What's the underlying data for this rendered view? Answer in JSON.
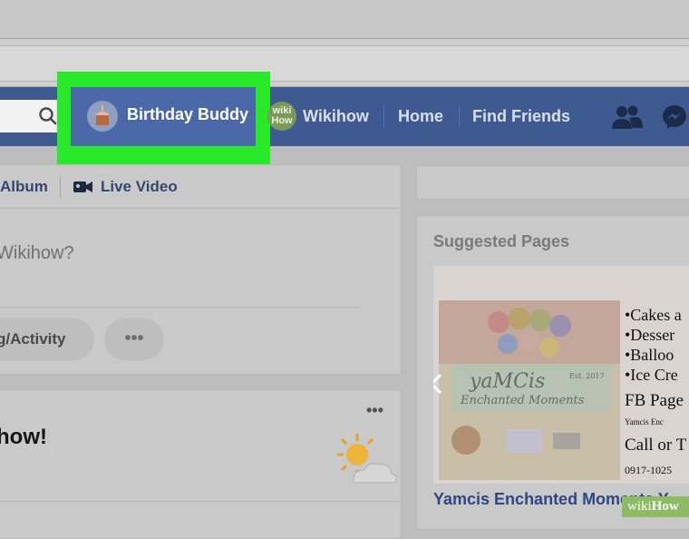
{
  "browser": {},
  "header": {
    "profile_name": "Birthday Buddy",
    "page_avatar_text": [
      "wiki",
      "How"
    ],
    "page_name": "Wikihow",
    "home_label": "Home",
    "find_friends_label": "Find Friends",
    "icons": [
      "search-icon",
      "friends-icon",
      "messenger-icon"
    ]
  },
  "composer": {
    "album_label": "Album",
    "live_video_label": "Live Video",
    "prompt": "Wikihow?",
    "activity_label": "g/Activity",
    "more_label": "•••"
  },
  "post": {
    "text": "how!",
    "more_label": "•••"
  },
  "sidebar": {
    "suggested_title": "Suggested Pages",
    "ad": {
      "logo_text": "yaMCis",
      "logo_subtext": "Enchanted Moments",
      "est": "Est. 2017",
      "bullets": [
        "•Cakes a",
        "•Desser",
        "•Balloo",
        "•Ice Cre"
      ],
      "fb_page": "FB Page",
      "small_line": "Yamcis Enc",
      "call": "Call or T",
      "phone": "0917-1025"
    },
    "page_name": "Yamcis Enchanted Moments Y"
  },
  "watermark": {
    "light": "wiki",
    "bold": "How"
  },
  "colors": {
    "facebook_bar": "#3f5a91",
    "highlight": "#28e928",
    "link": "#2d4784"
  }
}
